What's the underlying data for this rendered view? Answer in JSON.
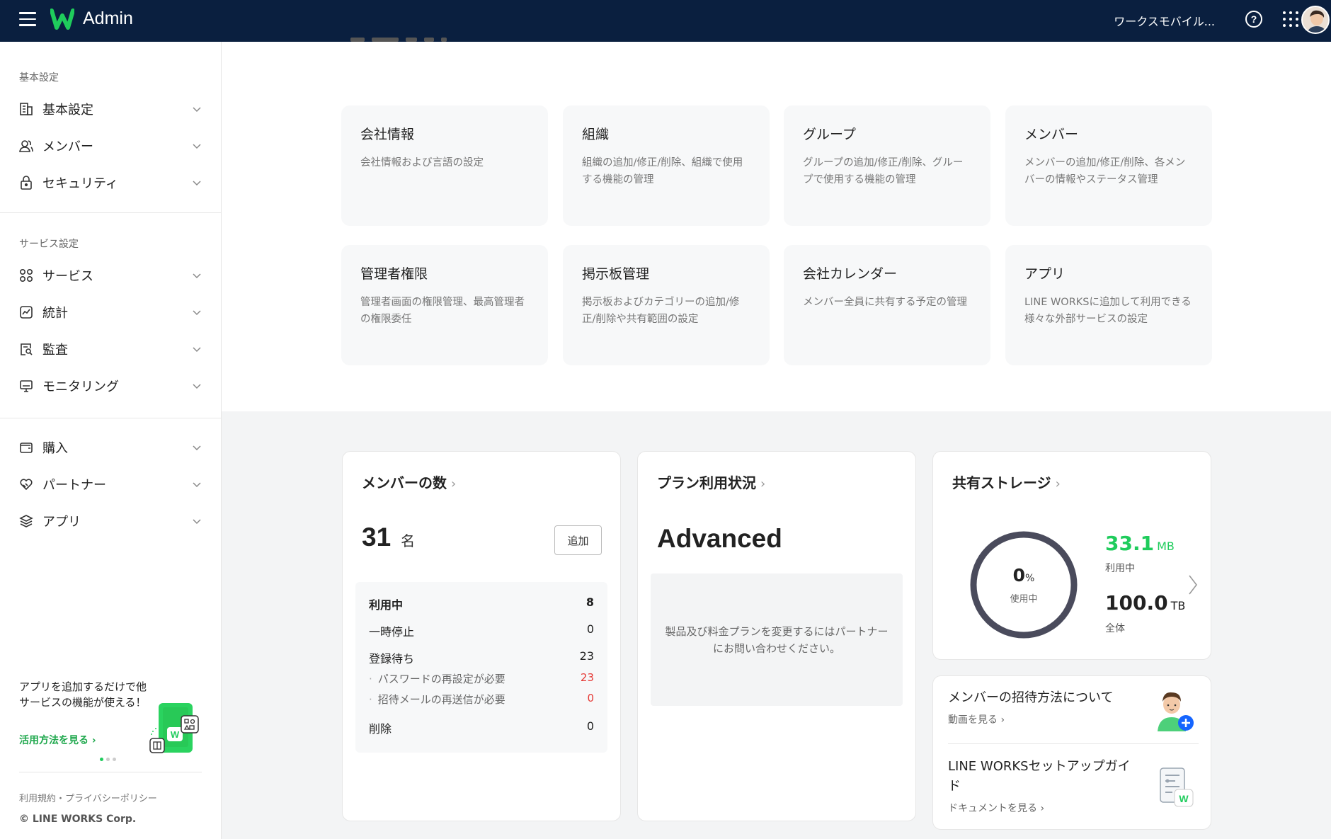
{
  "header": {
    "app_title": "Admin",
    "company_name": "ワークスモバイル...",
    "help_symbol": "?"
  },
  "sidebar": {
    "section1_label": "基本設定",
    "section2_label": "サービス設定",
    "items": [
      {
        "label": "基本設定",
        "icon": "building-icon"
      },
      {
        "label": "メンバー",
        "icon": "members-icon"
      },
      {
        "label": "セキュリティ",
        "icon": "lock-icon"
      },
      {
        "label": "サービス",
        "icon": "services-icon"
      },
      {
        "label": "統計",
        "icon": "statistics-icon"
      },
      {
        "label": "監査",
        "icon": "audit-icon"
      },
      {
        "label": "モニタリング",
        "icon": "monitor-icon"
      },
      {
        "label": "購入",
        "icon": "wallet-icon"
      },
      {
        "label": "パートナー",
        "icon": "partner-icon"
      },
      {
        "label": "アプリ",
        "icon": "layers-icon"
      }
    ],
    "promo": {
      "text": "アプリを追加するだけで他サービスの機能が使える！",
      "link": "活用方法を見る ›"
    },
    "footer": {
      "terms": "利用規約・プライバシーポリシー",
      "copyright": "© LINE WORKS Corp."
    }
  },
  "cards": [
    {
      "title": "会社情報",
      "desc": "会社情報および言語の設定"
    },
    {
      "title": "組織",
      "desc": "組織の追加/修正/削除、組織で使用する機能の管理"
    },
    {
      "title": "グループ",
      "desc": "グループの追加/修正/削除、グループで使用する機能の管理"
    },
    {
      "title": "メンバー",
      "desc": "メンバーの追加/修正/削除、各メンバーの情報やステータス管理"
    },
    {
      "title": "管理者権限",
      "desc": "管理者画面の権限管理、最高管理者の権限委任"
    },
    {
      "title": "掲示板管理",
      "desc": "掲示板およびカテゴリーの追加/修正/削除や共有範囲の設定"
    },
    {
      "title": "会社カレンダー",
      "desc": "メンバー全員に共有する予定の管理"
    },
    {
      "title": "アプリ",
      "desc": "LINE WORKSに追加して利用できる様々な外部サービスの設定"
    }
  ],
  "members_panel": {
    "title": "メンバーの数",
    "arrow": "›",
    "count": "31",
    "unit": "名",
    "add_label": "追加",
    "rows": [
      {
        "label": "利用中",
        "value": "8"
      },
      {
        "label": "一時停止",
        "value": "0"
      },
      {
        "label": "登録待ち",
        "value": "23"
      },
      {
        "label": "パスワードの再設定が必要",
        "value": "23"
      },
      {
        "label": "招待メールの再送信が必要",
        "value": "0"
      },
      {
        "label": "削除",
        "value": "0"
      }
    ]
  },
  "plan_panel": {
    "title": "プラン利用状況",
    "arrow": "›",
    "plan_name": "Advanced",
    "note": "製品及び料金プランを変更するにはパートナーにお問い合わせください。"
  },
  "storage_panel": {
    "title": "共有ストレージ",
    "arrow": "›",
    "percent": "0",
    "percent_unit": "%",
    "percent_label": "使用中",
    "used_value": "33.1",
    "used_unit": "MB",
    "used_label": "利用中",
    "total_value": "100.0",
    "total_unit": "TB",
    "total_label": "全体",
    "usage_fraction": 0.0
  },
  "links_panel": {
    "items": [
      {
        "title": "メンバーの招待方法について",
        "sub": "動画を見る ›"
      },
      {
        "title": "LINE WORKSセットアップガイド",
        "sub": "ドキュメントを見る ›"
      }
    ]
  },
  "colors": {
    "topbar": "#0a1f3f",
    "accent_green": "#1fcc5c",
    "alert_red": "#e53935",
    "ring": "#4a4b5c"
  }
}
